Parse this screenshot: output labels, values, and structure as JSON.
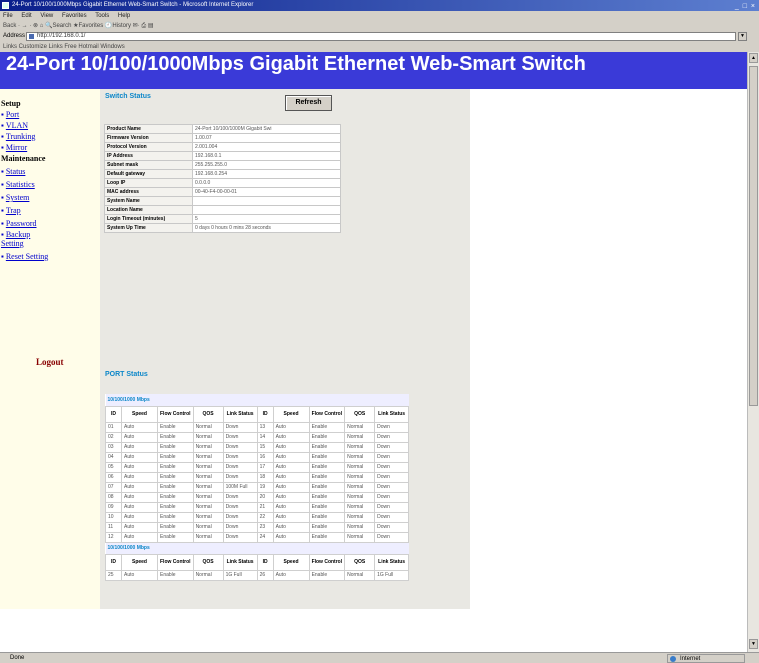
{
  "window": {
    "title": "24-Port 10/100/1000Mbps Gigabit Ethernet Web-Smart Switch - Microsoft Internet Explorer",
    "controls": "_ □ ×"
  },
  "menubar": {
    "items": [
      "File",
      "Edit",
      "View",
      "Favorites",
      "Tools",
      "Help"
    ]
  },
  "toolbar": {
    "text": "Back · → · ⊗ ⌂ 🔍Search ★Favorites 🕘History ✉· ⎙ ▤"
  },
  "address": {
    "label": "Address",
    "value": "http://192.168.0.1/"
  },
  "links": {
    "text": "Links  Customize Links  Free Hotmail  Windows"
  },
  "banner": {
    "title": "24-Port 10/100/1000Mbps Gigabit Ethernet Web-Smart Switch"
  },
  "sidebar": {
    "setup_label": "Setup",
    "setup_items": [
      "Port",
      "VLAN",
      "Trunking",
      "Mirror"
    ],
    "maintenance_label": "Maintenance",
    "maintenance_items": [
      "Status",
      "Statistics",
      "System",
      "Trap",
      "Password",
      "Backup Setting",
      "Reset Setting"
    ],
    "logout": "Logout"
  },
  "switch_status": {
    "heading": "Switch Status",
    "refresh_label": "Refresh",
    "rows": [
      {
        "key": "Product Name",
        "value": "24-Port 10/100/1000M Gigabit Swi"
      },
      {
        "key": "Firmware Version",
        "value": "1.00.07"
      },
      {
        "key": "Protocol Version",
        "value": "2.001.004"
      },
      {
        "key": "IP Address",
        "value": "192.168.0.1"
      },
      {
        "key": "Subnet mask",
        "value": "255.255.255.0"
      },
      {
        "key": "Default gateway",
        "value": "192.168.0.254"
      },
      {
        "key": "Loop IP",
        "value": "0.0.0.0"
      },
      {
        "key": "MAC address",
        "value": "00-40-F4-00-00-01"
      },
      {
        "key": "System Name",
        "value": ""
      },
      {
        "key": "Location Name",
        "value": ""
      },
      {
        "key": "Login Timeout (minutes)",
        "value": "5"
      },
      {
        "key": "System Up Time",
        "value": "0 days 0 hours 0 mins 28 seconds"
      }
    ]
  },
  "port_status": {
    "heading": "PORT Status",
    "group1_label": "10/100/1000 Mbps",
    "group2_label": "10/100/1000 Mbps",
    "headers": [
      "ID",
      "Speed",
      "Flow Control",
      "QOS",
      "Link Status",
      "ID",
      "Speed",
      "Flow Control",
      "QOS",
      "Link Status"
    ],
    "group1_rows": [
      [
        "01",
        "Auto",
        "Enable",
        "Normal",
        "Down",
        "13",
        "Auto",
        "Enable",
        "Normal",
        "Down"
      ],
      [
        "02",
        "Auto",
        "Enable",
        "Normal",
        "Down",
        "14",
        "Auto",
        "Enable",
        "Normal",
        "Down"
      ],
      [
        "03",
        "Auto",
        "Enable",
        "Normal",
        "Down",
        "15",
        "Auto",
        "Enable",
        "Normal",
        "Down"
      ],
      [
        "04",
        "Auto",
        "Enable",
        "Normal",
        "Down",
        "16",
        "Auto",
        "Enable",
        "Normal",
        "Down"
      ],
      [
        "05",
        "Auto",
        "Enable",
        "Normal",
        "Down",
        "17",
        "Auto",
        "Enable",
        "Normal",
        "Down"
      ],
      [
        "06",
        "Auto",
        "Enable",
        "Normal",
        "Down",
        "18",
        "Auto",
        "Enable",
        "Normal",
        "Down"
      ],
      [
        "07",
        "Auto",
        "Enable",
        "Normal",
        "100M Full",
        "19",
        "Auto",
        "Enable",
        "Normal",
        "Down"
      ],
      [
        "08",
        "Auto",
        "Enable",
        "Normal",
        "Down",
        "20",
        "Auto",
        "Enable",
        "Normal",
        "Down"
      ],
      [
        "09",
        "Auto",
        "Enable",
        "Normal",
        "Down",
        "21",
        "Auto",
        "Enable",
        "Normal",
        "Down"
      ],
      [
        "10",
        "Auto",
        "Enable",
        "Normal",
        "Down",
        "22",
        "Auto",
        "Enable",
        "Normal",
        "Down"
      ],
      [
        "11",
        "Auto",
        "Enable",
        "Normal",
        "Down",
        "23",
        "Auto",
        "Enable",
        "Normal",
        "Down"
      ],
      [
        "12",
        "Auto",
        "Enable",
        "Normal",
        "Down",
        "24",
        "Auto",
        "Enable",
        "Normal",
        "Down"
      ]
    ],
    "group2_rows": [
      [
        "25",
        "Auto",
        "Enable",
        "Normal",
        "1G Full",
        "26",
        "Auto",
        "Enable",
        "Normal",
        "1G Full"
      ]
    ]
  },
  "statusbar": {
    "left": "Done",
    "zone": "Internet"
  }
}
